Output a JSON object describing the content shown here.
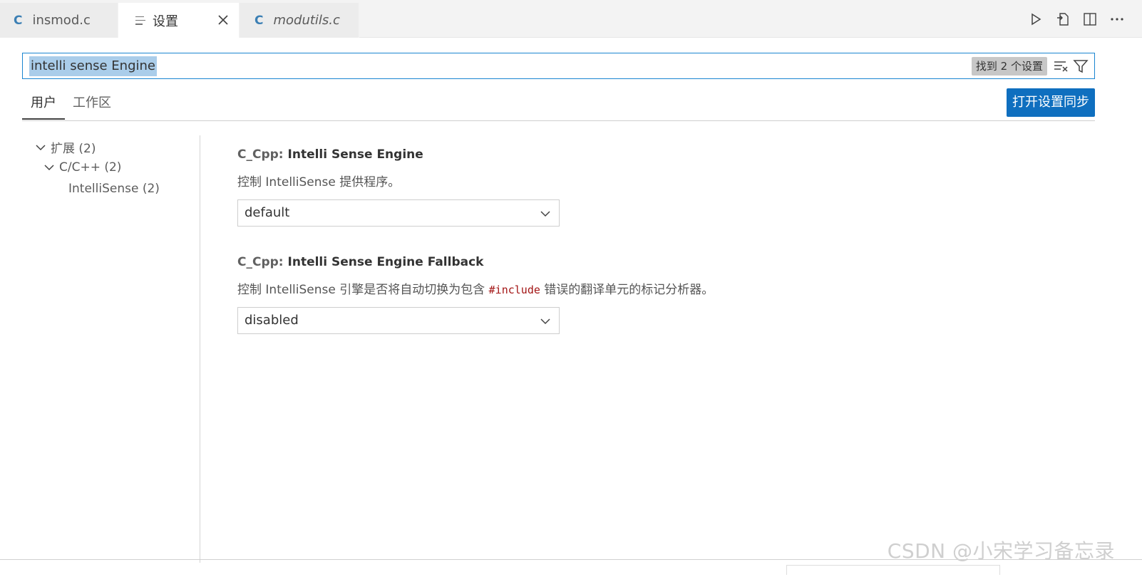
{
  "tabs": [
    {
      "label": "insmod.c",
      "icon": "c-file-icon"
    },
    {
      "label": "设置",
      "icon": "settings-editor-icon"
    },
    {
      "label": "modutils.c",
      "icon": "c-file-icon"
    }
  ],
  "search": {
    "value": "intelli sense Engine",
    "count": "找到 2 个设置"
  },
  "scope_tabs": [
    "用户",
    "工作区"
  ],
  "sync_button": "打开设置同步",
  "toc": [
    {
      "label": "扩展 (2)"
    },
    {
      "label": "C/C++ (2)"
    },
    {
      "label": "IntelliSense (2)"
    }
  ],
  "settings": [
    {
      "category": "C_Cpp: ",
      "name": "Intelli Sense Engine",
      "description": "控制 IntelliSense 提供程序。",
      "value": "default"
    },
    {
      "category": "C_Cpp: ",
      "name": "Intelli Sense Engine Fallback",
      "description_pre": "控制 IntelliSense 引擎是否将自动切换为包含 ",
      "description_code": "#include",
      "description_post": " 错误的翻译单元的标记分析器。",
      "value": "disabled"
    }
  ],
  "watermark": "CSDN @小宋学习备忘录"
}
